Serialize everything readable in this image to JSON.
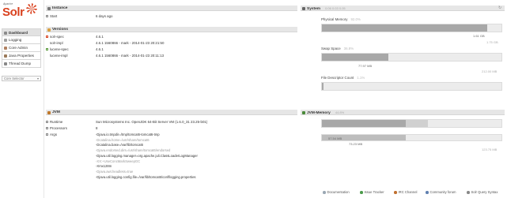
{
  "logo": {
    "apache": "Apache",
    "solr": "Solr"
  },
  "nav": [
    {
      "label": "Dashboard",
      "icon": "dashboard-icon",
      "color": "#8a8a8a"
    },
    {
      "label": "Logging",
      "icon": "logging-icon",
      "color": "#a0a0a0"
    },
    {
      "label": "Core Admin",
      "icon": "core-admin-icon",
      "color": "#b08060"
    },
    {
      "label": "Java Properties",
      "icon": "java-properties-icon",
      "color": "#9a7a5a"
    },
    {
      "label": "Thread Dump",
      "icon": "thread-dump-icon",
      "color": "#888888"
    }
  ],
  "core_selector": {
    "placeholder": "Core Selector"
  },
  "instance": {
    "title": "Instance",
    "start_label": "Start",
    "start_value": "6 days ago"
  },
  "versions": {
    "title": "Versions",
    "rows": [
      {
        "key": "solr-spec",
        "value": "4.6.1"
      },
      {
        "key": "solr-impl",
        "value": "4.6.1 1560866 - mark - 2014-01-23 20:21:50"
      },
      {
        "key": "lucene-spec",
        "value": "4.6.1"
      },
      {
        "key": "lucene-impl",
        "value": "4.6.1 1560866 - mark - 2014-01-23 20:11:13"
      }
    ]
  },
  "jvm": {
    "title": "JVM",
    "runtime_label": "Runtime",
    "runtime_value": "Sun Microsystems Inc. OpenJDK 64-Bit Server VM (1.6.0_31 23.25-b01)",
    "processors_label": "Processors",
    "processors_value": "8",
    "args_label": "Args",
    "args": [
      {
        "text": "-Djava.io.tmpdir=/tmp/tomcat6-tomcat6-tmp",
        "dim": false
      },
      {
        "text": "-Dcatalina.home=/usr/share/tomcat6",
        "dim": true
      },
      {
        "text": "-Dcatalina.base=/var/lib/tomcat6",
        "dim": false
      },
      {
        "text": "-Djava.endorsed.dirs=/usr/share/tomcat6/endorsed",
        "dim": true
      },
      {
        "text": "-Djava.util.logging.manager=org.apache.juli.ClassLoaderLogManager",
        "dim": false
      },
      {
        "text": "-XX:+UseConcMarkSweepGC",
        "dim": true
      },
      {
        "text": "-Xmx128m",
        "dim": false
      },
      {
        "text": "-Djava.awt.headless=true",
        "dim": true
      },
      {
        "text": "-Djava.util.logging.config.file=/var/lib/tomcat6/conf/logging.properties",
        "dim": false
      }
    ]
  },
  "system": {
    "title": "System",
    "load": "0.06 0.03 0.05",
    "physical_memory": {
      "label": "Physical Memory",
      "pct": "92.0%",
      "used": "1.61 GB",
      "max": "1.75 GB",
      "fill": 0.92
    },
    "swap_space": {
      "label": "Swap Space",
      "pct": "36.8%",
      "used": "77.97 MB",
      "max": "212.00 MB",
      "fill": 0.368
    },
    "file_descriptor": {
      "label": "File Descriptor Count",
      "pct": "1.1%",
      "fill": 0.011
    }
  },
  "jvm_memory": {
    "title": "JVM-Memory",
    "pct": "44.8%",
    "used": "57.54 MB",
    "allocated": "73.23 MB",
    "max": "123.75 MB",
    "used_fill": 0.465,
    "alloc_fill": 0.592
  },
  "footer": [
    {
      "label": "Documentation",
      "color": "#9aa7b3"
    },
    {
      "label": "Issue Tracker",
      "color": "#4a9a4a"
    },
    {
      "label": "IRC Channel",
      "color": "#c07030"
    },
    {
      "label": "Community forum",
      "color": "#6080b0"
    },
    {
      "label": "Solr Query Syntax",
      "color": "#888888"
    }
  ]
}
